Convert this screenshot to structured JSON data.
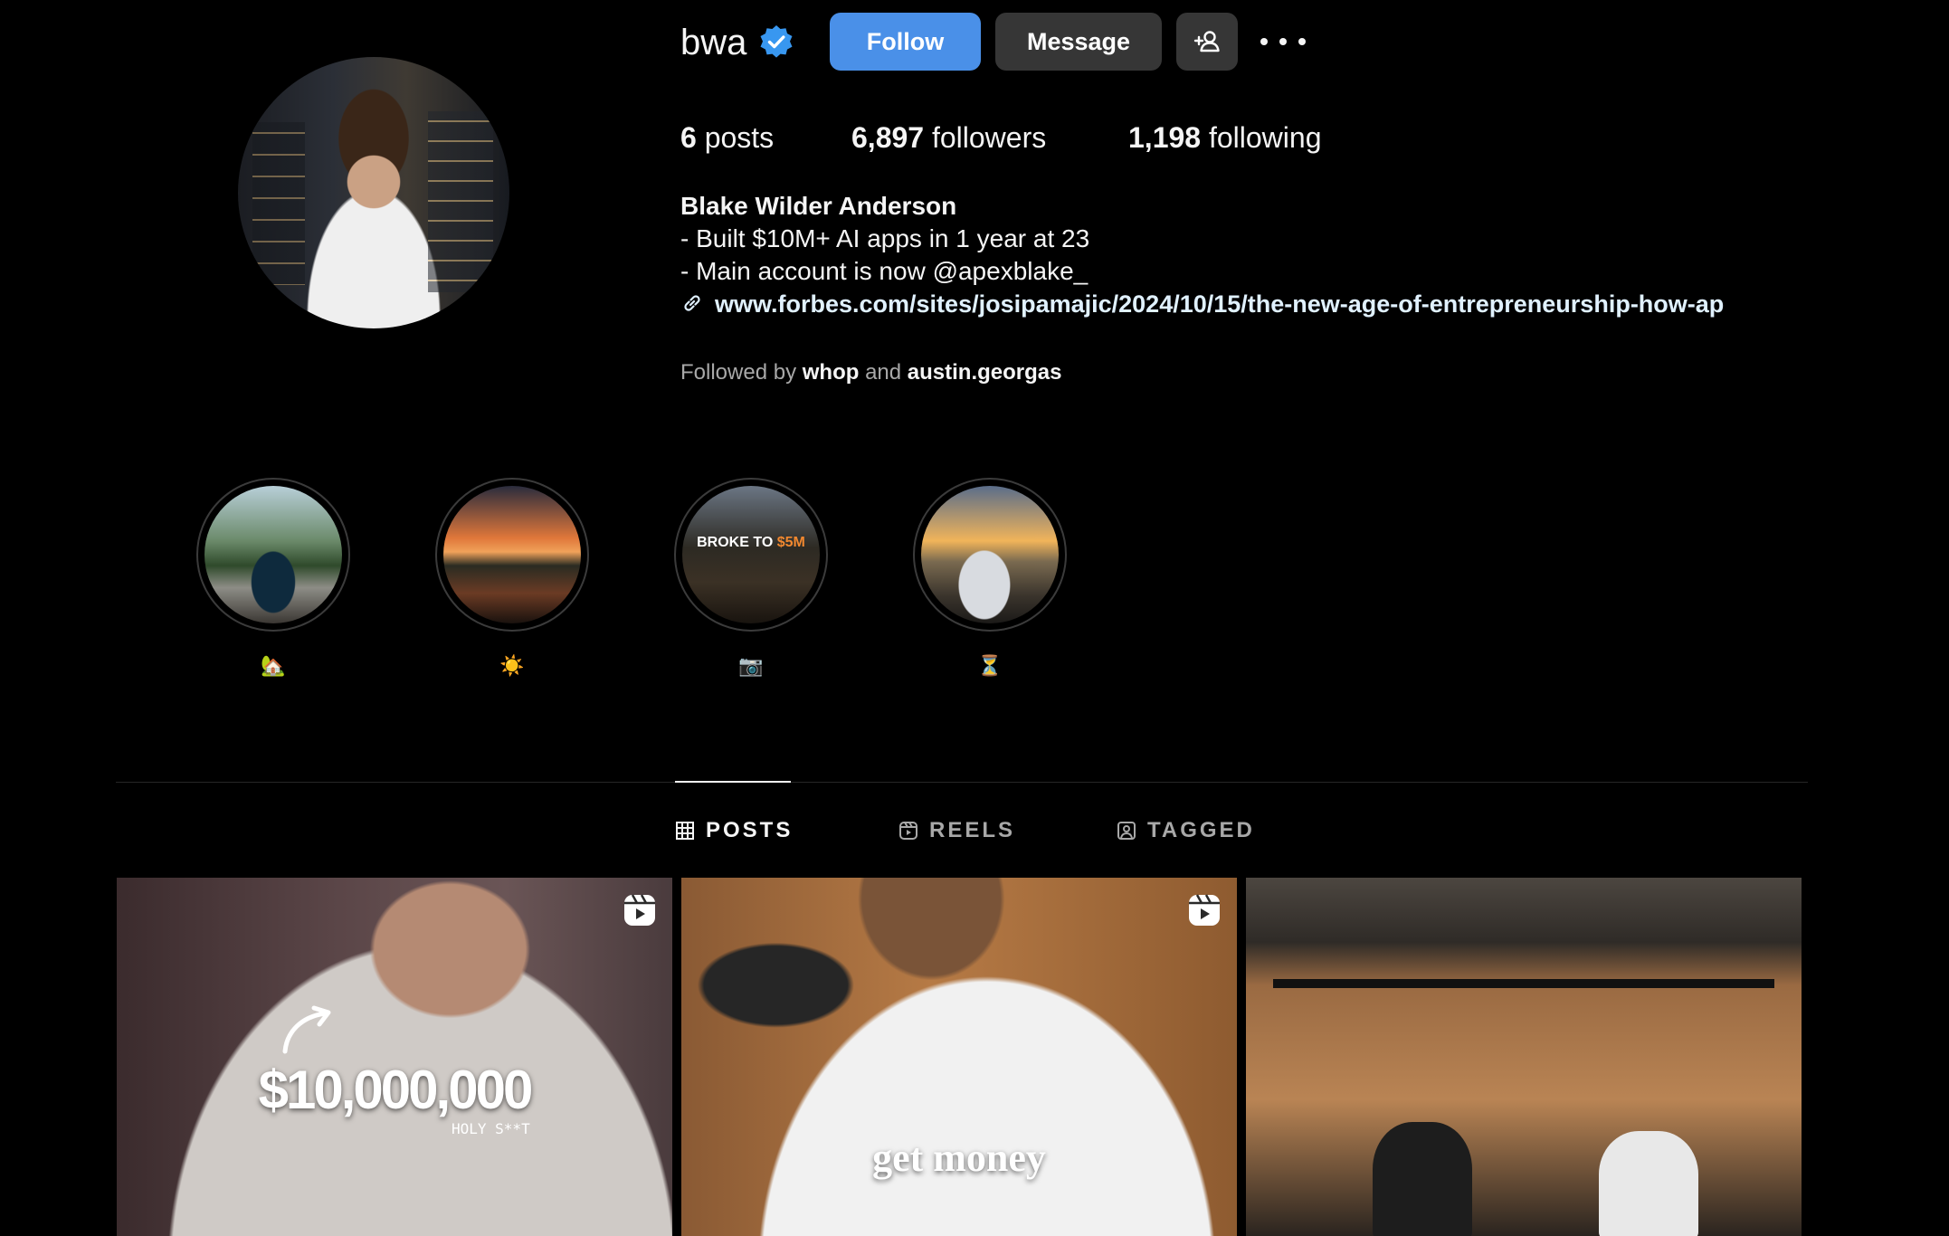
{
  "profile": {
    "username": "bwa",
    "follow_label": "Follow",
    "message_label": "Message",
    "stats": {
      "posts_count": "6",
      "posts_label": "posts",
      "followers_count": "6,897",
      "followers_label": "followers",
      "following_count": "1,198",
      "following_label": "following"
    },
    "full_name": "Blake Wilder Anderson",
    "bio": [
      "- Built $10M+ AI apps in 1 year at 23",
      "- Main account is now @apexblake_"
    ],
    "link": "www.forbes.com/sites/josipamajic/2024/10/15/the-new-age-of-entrepreneurship-how-ap",
    "followed_by_prefix": "Followed by",
    "followed_by_1": "whop",
    "followed_by_and": "and",
    "followed_by_2": "austin.georgas"
  },
  "highlights": [
    {
      "label": "🏡"
    },
    {
      "label": "☀️"
    },
    {
      "label": "📷",
      "overlay_text": "BROKE TO",
      "overlay_accent": "$5M"
    },
    {
      "label": "⏳"
    }
  ],
  "tabs": [
    {
      "label": "POSTS",
      "icon": "grid-icon",
      "active": true
    },
    {
      "label": "REELS",
      "icon": "reels-icon",
      "active": false
    },
    {
      "label": "TAGGED",
      "icon": "tagged-icon",
      "active": false
    }
  ],
  "posts": [
    {
      "caption": "$10,000,000",
      "subcaption": "HOLY S**T",
      "is_reel": true
    },
    {
      "caption": "get money",
      "is_reel": true
    },
    {
      "is_reel": false
    }
  ],
  "colors": {
    "background": "#000000",
    "follow_button": "#4a90e8",
    "secondary_button": "#363636",
    "verified_badge": "#3897f0",
    "link_text": "#e0f1ff",
    "muted_text": "#a8a8a8"
  }
}
